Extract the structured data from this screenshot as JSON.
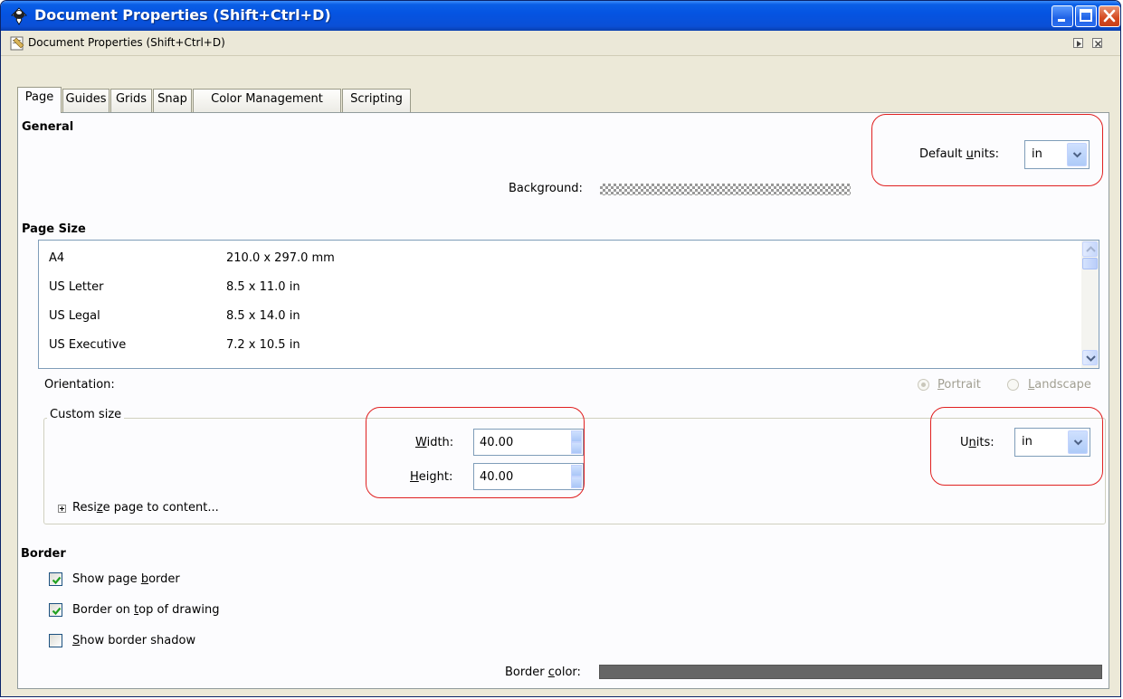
{
  "window": {
    "title": "Document Properties (Shift+Ctrl+D)",
    "buttons": [
      "minimize",
      "maximize",
      "close"
    ]
  },
  "dock": {
    "title": "Document Properties (Shift+Ctrl+D)"
  },
  "tabs": [
    {
      "label": "Page",
      "active": true
    },
    {
      "label": "Guides",
      "active": false
    },
    {
      "label": "Grids",
      "active": false
    },
    {
      "label": "Snap",
      "active": false
    },
    {
      "label": "Color Management",
      "active": false
    },
    {
      "label": "Scripting",
      "active": false
    }
  ],
  "general": {
    "heading": "General",
    "default_units_pre": "Default ",
    "default_units_u": "u",
    "default_units_post": "nits:",
    "default_units_value": "in",
    "background_label": "Background:"
  },
  "page_size": {
    "heading": "Page Size",
    "rows": [
      {
        "name": "A4",
        "size": "210.0 x 297.0 mm"
      },
      {
        "name": "US Letter",
        "size": "8.5 x 11.0 in"
      },
      {
        "name": "US Legal",
        "size": "8.5 x 14.0 in"
      },
      {
        "name": "US Executive",
        "size": "7.2 x 10.5 in"
      }
    ],
    "orientation_label": "Orientation:",
    "portrait_u": "P",
    "portrait_rest": "ortrait",
    "landscape_u": "L",
    "landscape_rest": "andscape",
    "orientation_selected": "Portrait"
  },
  "custom_size": {
    "title": "Custom size",
    "width_u": "W",
    "width_rest": "idth:",
    "width_value": "40.00",
    "height_u": "H",
    "height_rest": "eight:",
    "height_value": "40.00",
    "units_pre": "U",
    "units_u": "n",
    "units_post": "its:",
    "units_value": "in",
    "resize_pre": "Resi",
    "resize_u": "z",
    "resize_post": "e page to content..."
  },
  "border": {
    "heading": "Border",
    "show_border_pre": "Show page ",
    "show_border_u": "b",
    "show_border_post": "order",
    "show_border_checked": true,
    "on_top_pre": "Border on ",
    "on_top_u": "t",
    "on_top_post": "op of drawing",
    "on_top_checked": true,
    "shadow_u": "S",
    "shadow_post": "how border shadow",
    "shadow_checked": false,
    "color_pre": "Border ",
    "color_u": "c",
    "color_post": "olor:",
    "border_color": "#666666"
  },
  "colors": {
    "title_bar": "#0554e2",
    "annotation": "#e02020",
    "panel_bg": "#fcfcfe"
  }
}
